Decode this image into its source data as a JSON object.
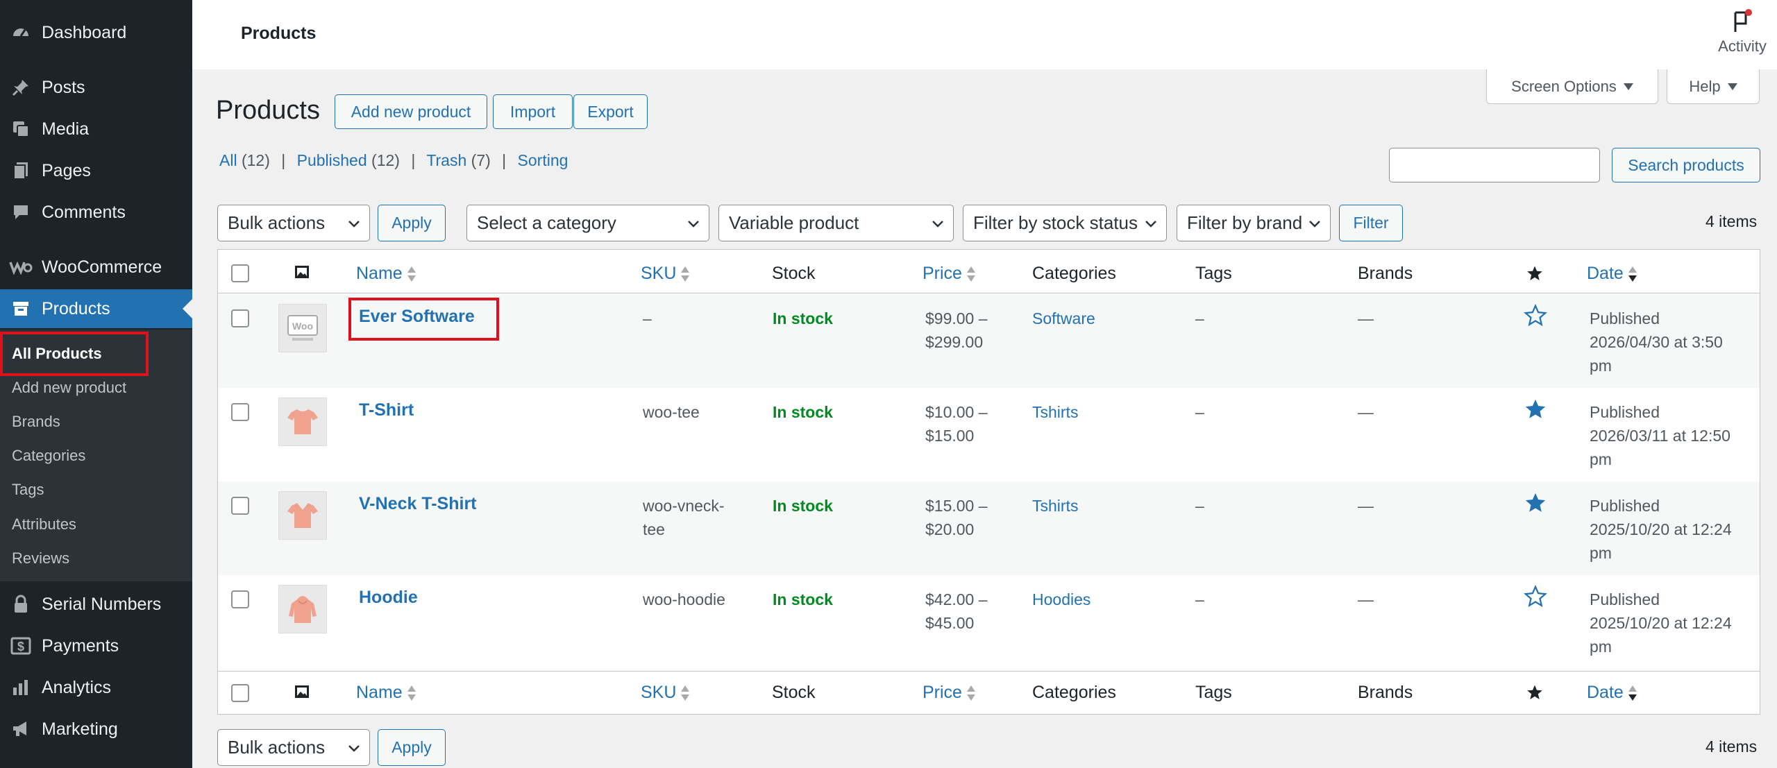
{
  "sidebar": {
    "items": [
      {
        "label": "Dashboard",
        "icon": "dashboard-icon"
      },
      {
        "label": "Posts",
        "icon": "pin-icon"
      },
      {
        "label": "Media",
        "icon": "media-icon"
      },
      {
        "label": "Pages",
        "icon": "pages-icon"
      },
      {
        "label": "Comments",
        "icon": "comment-icon"
      },
      {
        "label": "WooCommerce",
        "icon": "woo-icon"
      },
      {
        "label": "Products",
        "icon": "archive-icon"
      },
      {
        "label": "Serial Numbers",
        "icon": "lock-icon"
      },
      {
        "label": "Payments",
        "icon": "dollar-icon"
      },
      {
        "label": "Analytics",
        "icon": "bar-chart-icon"
      },
      {
        "label": "Marketing",
        "icon": "megaphone-icon"
      }
    ],
    "submenu": [
      "All Products",
      "Add new product",
      "Brands",
      "Categories",
      "Tags",
      "Attributes",
      "Reviews"
    ]
  },
  "header": {
    "title": "Products",
    "activity_label": "Activity"
  },
  "screen_options_label": "Screen Options",
  "help_label": "Help",
  "page": {
    "heading": "Products",
    "add_new": "Add new product",
    "import": "Import",
    "export": "Export"
  },
  "views": {
    "all": "All",
    "all_count": "(12)",
    "published": "Published",
    "published_count": "(12)",
    "trash": "Trash",
    "trash_count": "(7)",
    "sorting": "Sorting",
    "separator": "|"
  },
  "search": {
    "button": "Search products",
    "value": ""
  },
  "filters": {
    "bulk_actions": "Bulk actions",
    "apply": "Apply",
    "category": "Select a category",
    "product_type": "Variable product",
    "stock_status": "Filter by stock status",
    "brand": "Filter by brand",
    "filter": "Filter",
    "items_count": "4 items"
  },
  "columns": {
    "name": "Name",
    "sku": "SKU",
    "stock": "Stock",
    "price": "Price",
    "categories": "Categories",
    "tags": "Tags",
    "brands": "Brands",
    "date": "Date"
  },
  "products": [
    {
      "name": "Ever Software",
      "sku": "–",
      "stock": "In stock",
      "price_line1": "$99.00 –",
      "price_line2": "$299.00",
      "category": "Software",
      "tags": "–",
      "brands": "—",
      "featured": false,
      "date_status": "Published",
      "date_line": "2026/04/30 at 3:50",
      "date_line2": "pm",
      "thumb": "woo-placeholder"
    },
    {
      "name": "T-Shirt",
      "sku": "woo-tee",
      "sku_line2": "",
      "stock": "In stock",
      "price_line1": "$10.00 –",
      "price_line2": "$15.00",
      "category": "Tshirts",
      "tags": "–",
      "brands": "—",
      "featured": true,
      "date_status": "Published",
      "date_line": "2026/03/11 at 12:50",
      "date_line2": "pm",
      "thumb": "tshirt"
    },
    {
      "name": "V-Neck T-Shirt",
      "sku": "woo-vneck-",
      "sku_line2": "tee",
      "stock": "In stock",
      "price_line1": "$15.00 –",
      "price_line2": "$20.00",
      "category": "Tshirts",
      "tags": "–",
      "brands": "—",
      "featured": true,
      "date_status": "Published",
      "date_line": "2025/10/20 at 12:24",
      "date_line2": "pm",
      "thumb": "tshirt"
    },
    {
      "name": "Hoodie",
      "sku": "woo-hoodie",
      "sku_line2": "",
      "stock": "In stock",
      "price_line1": "$42.00 –",
      "price_line2": "$45.00",
      "category": "Hoodies",
      "tags": "–",
      "brands": "—",
      "featured": false,
      "date_status": "Published",
      "date_line": "2025/10/20 at 12:24",
      "date_line2": "pm",
      "thumb": "hoodie"
    }
  ],
  "colors": {
    "accent": "#2271b1",
    "sidebar": "#1d2327",
    "stock": "#008a20",
    "highlight": "#e0101d"
  }
}
